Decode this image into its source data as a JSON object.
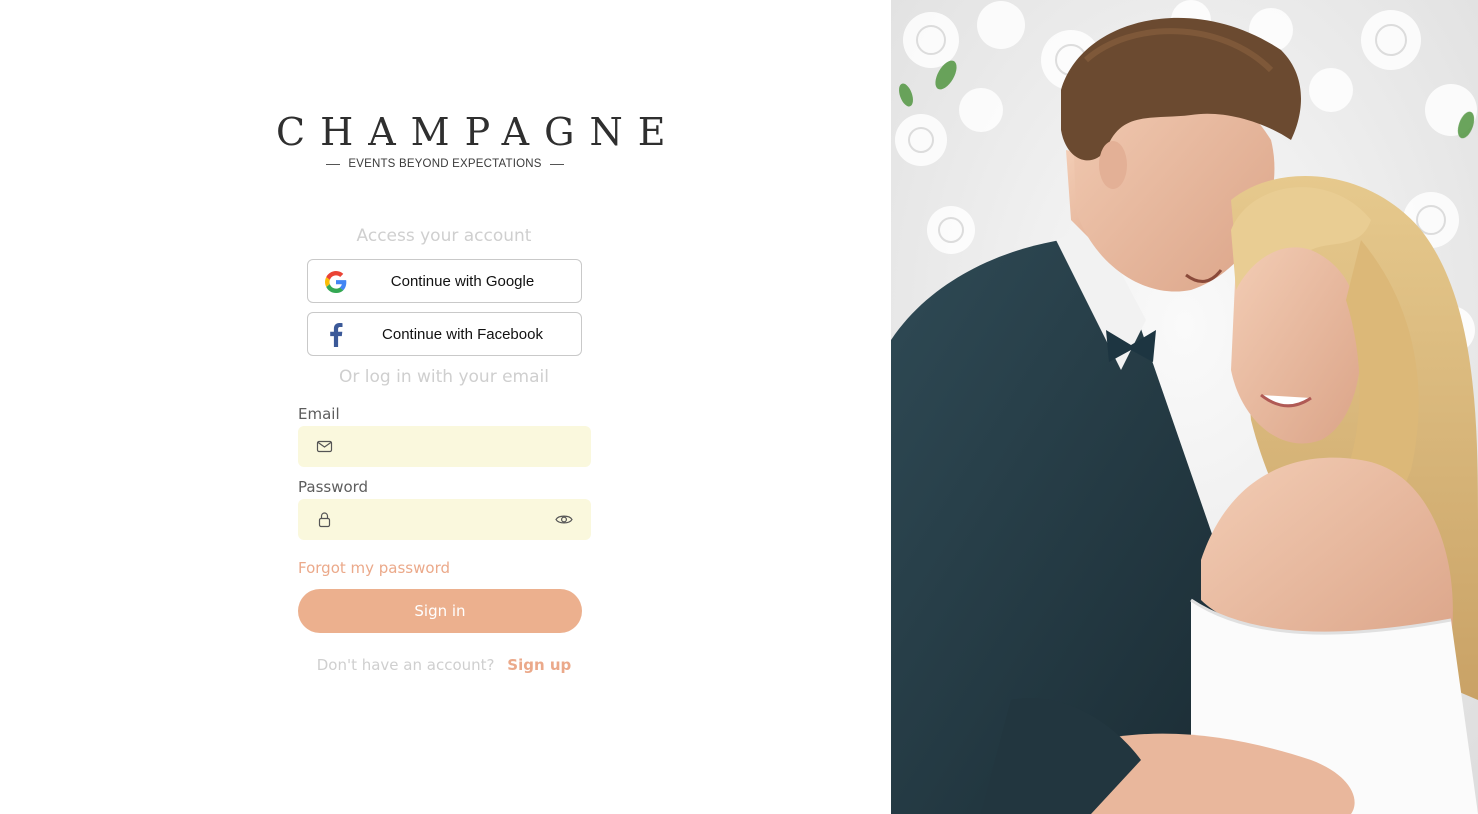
{
  "brand": {
    "name": "CHAMPAGNE",
    "tagline": "EVENTS BEYOND EXPECTATIONS"
  },
  "login": {
    "heading": "Access your account",
    "google_label": "Continue with Google",
    "facebook_label": "Continue with Facebook",
    "divider_text": "Or log in with your email",
    "email_label": "Email",
    "email_value": "",
    "password_label": "Password",
    "password_value": "",
    "forgot_label": "Forgot my password",
    "signin_label": "Sign in",
    "signup_question": "Don't have an account?",
    "signup_link": "Sign up"
  },
  "icons": {
    "google": "google-icon",
    "facebook": "facebook-icon",
    "email": "mail-icon",
    "password": "lock-icon",
    "toggle_password": "eye-icon"
  },
  "colors": {
    "accent": "#ecb08e",
    "link": "#eba98a",
    "input_bg": "#faf8dd",
    "muted_text": "#cfcfcf"
  }
}
